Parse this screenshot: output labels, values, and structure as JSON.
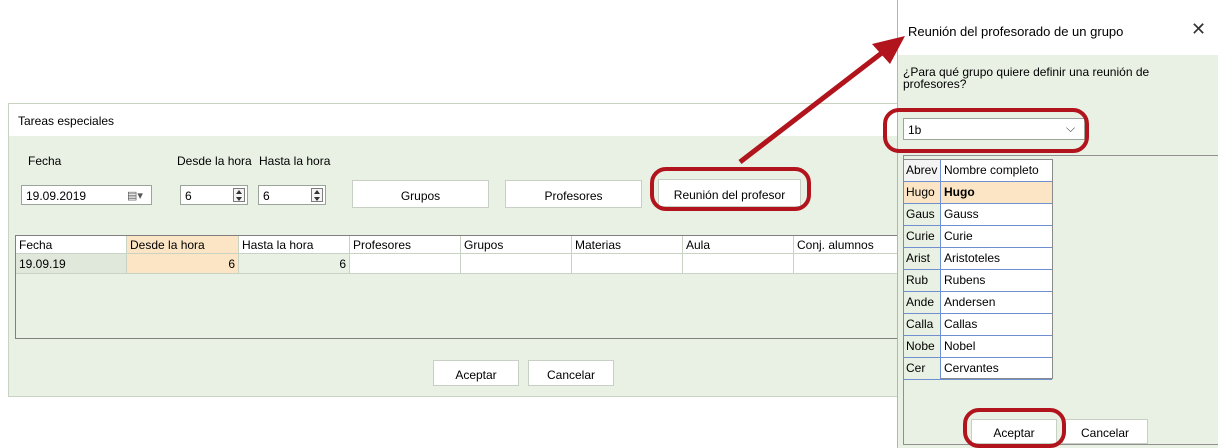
{
  "main_dialog": {
    "title": "Tareas especiales",
    "fecha_label": "Fecha",
    "desde_label": "Desde la hora",
    "hasta_label": "Hasta la hora",
    "fecha_value": "19.09.2019",
    "desde_value": "6",
    "hasta_value": "6",
    "buttons": {
      "grupos": "Grupos",
      "profesores": "Profesores",
      "reunion": "Reunión del profesor"
    },
    "grid": {
      "columns": [
        "Fecha",
        "Desde la hora",
        "Hasta la hora",
        "Profesores",
        "Grupos",
        "Materias",
        "Aula",
        "Conj. alumnos"
      ],
      "rows": [
        {
          "fecha": "19.09.19",
          "desde": "6",
          "hasta": "6",
          "profesores": "",
          "grupos": "",
          "materias": "",
          "aula": "",
          "conj": ""
        }
      ]
    },
    "accept": "Aceptar",
    "cancel": "Cancelar"
  },
  "group_dialog": {
    "title": "Reunión del profesorado de un grupo",
    "close_icon": "close-icon",
    "prompt": "¿Para qué grupo quiere definir una reunión de profesores?",
    "selected_group": "1b",
    "list_header": {
      "abbr": "Abrev",
      "name": "Nombre completo"
    },
    "list": [
      {
        "abbr": "Hugo",
        "name": "Hugo"
      },
      {
        "abbr": "Gaus",
        "name": "Gauss"
      },
      {
        "abbr": "Curie",
        "name": "Curie"
      },
      {
        "abbr": "Arist",
        "name": "Aristoteles"
      },
      {
        "abbr": "Rub",
        "name": "Rubens"
      },
      {
        "abbr": "Ande",
        "name": "Andersen"
      },
      {
        "abbr": "Calla",
        "name": "Callas"
      },
      {
        "abbr": "Nobe",
        "name": "Nobel"
      },
      {
        "abbr": "Cer",
        "name": "Cervantes"
      }
    ],
    "accept": "Aceptar",
    "cancel": "Cancelar"
  },
  "colors": {
    "dialog_bg": "#e9f1e4",
    "highlight_row": "#fbe5c4",
    "annotation_red": "#b1141d"
  }
}
